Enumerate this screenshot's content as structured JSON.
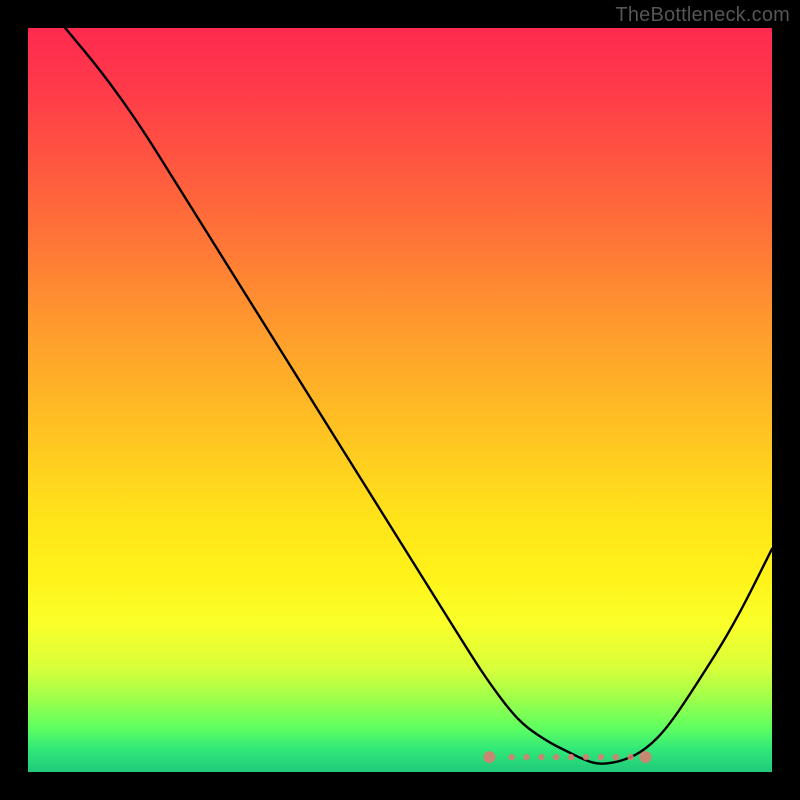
{
  "watermark": "TheBottleneck.com",
  "colors": {
    "page_bg": "#000000",
    "gradient_top": "#ff2a4f",
    "gradient_bottom": "#20c97a",
    "curve": "#000000",
    "marker": "#e0796f"
  },
  "chart_data": {
    "type": "line",
    "title": "",
    "xlabel": "",
    "ylabel": "",
    "xlim": [
      0,
      100
    ],
    "ylim": [
      0,
      100
    ],
    "x": [
      5,
      10,
      15,
      20,
      25,
      30,
      35,
      40,
      45,
      50,
      55,
      60,
      62,
      65,
      67,
      70,
      72,
      75,
      77,
      80,
      83,
      86,
      90,
      95,
      100
    ],
    "y": [
      100,
      94,
      87,
      79,
      71,
      63,
      55,
      47,
      39,
      31,
      23,
      15,
      12,
      8,
      6,
      4,
      3,
      1.5,
      1,
      1.5,
      3,
      6,
      12,
      20,
      30
    ],
    "flat_segment": {
      "x_start": 62,
      "x_end": 83,
      "points_plotted_x": [
        62,
        65,
        67,
        69,
        71,
        73,
        75,
        77,
        79,
        81,
        83
      ],
      "y_approx": 2
    },
    "note": "Curve depicts a bottleneck-percentage style plot: high value on the left descending quasi-linearly, flattening near zero around x≈70–80, then rising again toward the right. Numbers are estimated from gridless gradient; precision ≈ ±5."
  }
}
